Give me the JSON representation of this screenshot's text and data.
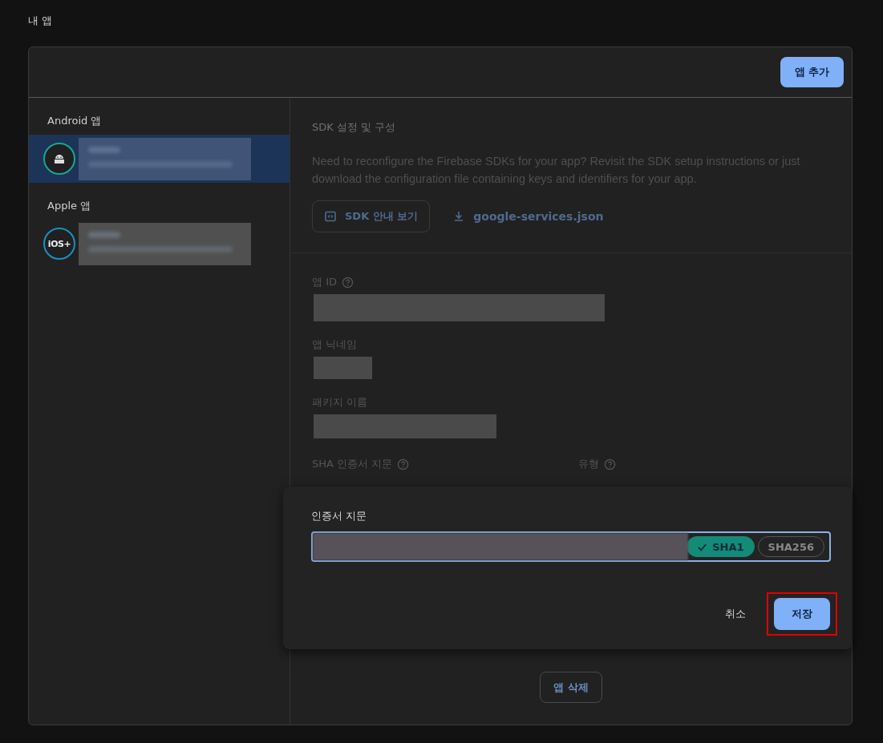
{
  "page_title": "내 앱",
  "toolbar": {
    "add_button": "앱 추가"
  },
  "sidebar": {
    "sections": [
      {
        "heading": "Android 앱",
        "apps": [
          {
            "kind": "android",
            "selected": true
          }
        ]
      },
      {
        "heading": "Apple 앱",
        "apps": [
          {
            "kind": "ios",
            "badge": "iOS+",
            "selected": false
          }
        ]
      }
    ]
  },
  "sdk_section": {
    "title": "SDK 설정 및 구성",
    "description": "Need to reconfigure the Firebase SDKs for your app? Revisit the SDK setup instructions or just download the configuration file containing keys and identifiers for your app.",
    "guide_button": "SDK 안내 보기",
    "download_link": "google-services.json"
  },
  "fields": [
    {
      "label": "앱 ID",
      "help": true,
      "kind": "long"
    },
    {
      "label": "앱 닉네임",
      "help": false,
      "kind": "short"
    },
    {
      "label": "패키지 이름",
      "help": false,
      "kind": "medium"
    }
  ],
  "sha_header": {
    "fingerprint": "SHA 인증서 지문",
    "type": "유형"
  },
  "dialog": {
    "label": "인증서 지문",
    "types": [
      {
        "label": "SHA1",
        "selected": true
      },
      {
        "label": "SHA256",
        "selected": false
      }
    ],
    "cancel": "취소",
    "save": {
      "label": "저장",
      "highlighted": true
    }
  },
  "delete_button": "앱 삭제"
}
